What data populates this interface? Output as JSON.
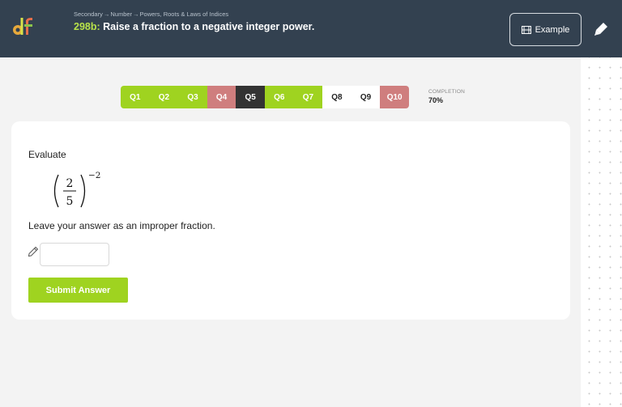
{
  "header": {
    "logo_text": "df",
    "breadcrumb": [
      "Secondary",
      "Number",
      "Powers, Roots & Laws of Indices"
    ],
    "breadcrumb_sep": "→",
    "code": "298b:",
    "title": "Raise a fraction to a negative integer power.",
    "example_label": "Example"
  },
  "questions": [
    {
      "label": "Q1",
      "status": "correct"
    },
    {
      "label": "Q2",
      "status": "correct"
    },
    {
      "label": "Q3",
      "status": "correct"
    },
    {
      "label": "Q4",
      "status": "wrong"
    },
    {
      "label": "Q5",
      "status": "current"
    },
    {
      "label": "Q6",
      "status": "correct"
    },
    {
      "label": "Q7",
      "status": "correct"
    },
    {
      "label": "Q8",
      "status": "pending"
    },
    {
      "label": "Q9",
      "status": "pending"
    },
    {
      "label": "Q10",
      "status": "wrong"
    }
  ],
  "completion": {
    "label": "COMPLETION",
    "value": "70%"
  },
  "question": {
    "prompt": "Evaluate",
    "numerator": "2",
    "denominator": "5",
    "exponent": "−2",
    "instruction": "Leave your answer as an improper fraction.",
    "answer_value": "",
    "submit_label": "Submit Answer"
  },
  "colors": {
    "header_bg": "#334150",
    "accent_green": "#9fd320",
    "wrong_red": "#cf7e7e",
    "current_dark": "#333333"
  }
}
